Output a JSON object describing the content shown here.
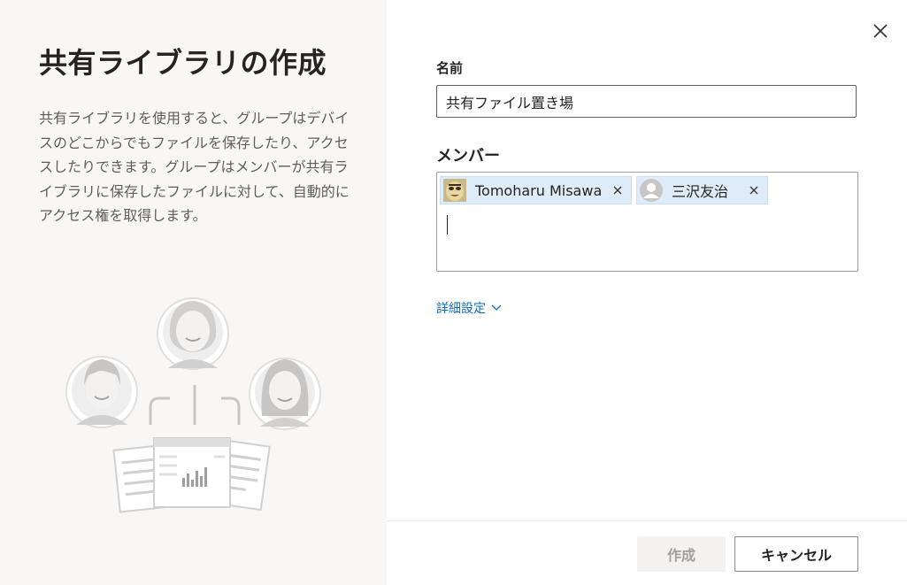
{
  "panel": {
    "title": "共有ライブラリの作成",
    "description": "共有ライブラリを使用すると、グループはデバイスのどこからでもファイルを保存したり、アクセスしたりできます。グループはメンバーが共有ライブラリに保存したファイルに対して、自動的にアクセス権を取得します。",
    "illustration_icon": "people-sharing-files-illustration"
  },
  "form": {
    "name_label": "名前",
    "name_value": "共有ファイル置き場",
    "members_label": "メンバー",
    "members": [
      {
        "name": "Tomoharu Misawa",
        "avatar_icon": "custom-avatar"
      },
      {
        "name": "三沢友治",
        "avatar_icon": "default-person-avatar"
      }
    ],
    "advanced_label": "詳細設定"
  },
  "footer": {
    "create_label": "作成",
    "cancel_label": "キャンセル"
  },
  "colors": {
    "left_panel_bg": "#f8f7f6",
    "chip_bg": "#deecf9",
    "link": "#0f6cbd",
    "disabled_button_bg": "#f3f2f1"
  }
}
